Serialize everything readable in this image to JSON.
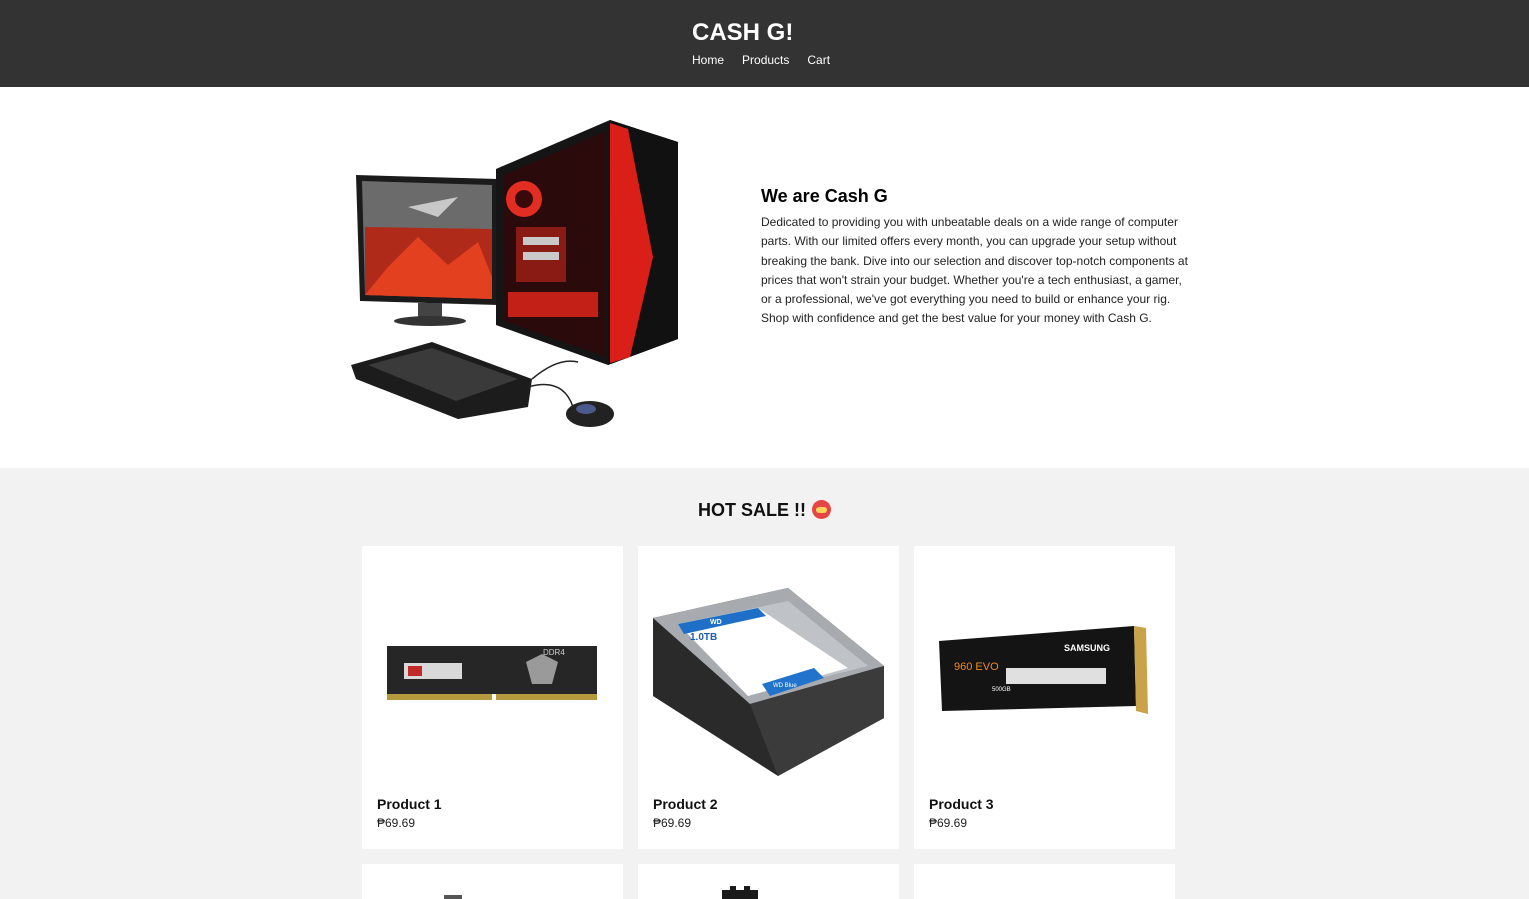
{
  "header": {
    "brand": "CASH G!",
    "nav": [
      "Home",
      "Products",
      "Cart"
    ]
  },
  "about": {
    "title": "We are Cash G",
    "body": "Dedicated to providing you with unbeatable deals on a wide range of computer parts. With our limited offers every month, you can upgrade your setup without breaking the bank. Dive into our selection and discover top-notch components at prices that won't strain your budget. Whether you're a tech enthusiast, a gamer, or a professional, we've got everything you need to build or enhance your rig. Shop with confidence and get the best value for your money with Cash G."
  },
  "sale": {
    "title": "HOT SALE !!",
    "emoji_icon": "angry-face-emoji"
  },
  "products": [
    {
      "name": "Product 1",
      "price": "₱69.69",
      "image": "ram-stick"
    },
    {
      "name": "Product 2",
      "price": "₱69.69",
      "image": "hard-drive"
    },
    {
      "name": "Product 3",
      "price": "₱69.69",
      "image": "m2-ssd"
    }
  ],
  "product_images": {
    "ram_label": "DDR4",
    "hdd_capacity": "1.0TB",
    "hdd_brand": "WD",
    "hdd_model": "WD Blue",
    "ssd_brand": "SAMSUNG",
    "ssd_model": "960 EVO",
    "ssd_size": "500GB"
  }
}
